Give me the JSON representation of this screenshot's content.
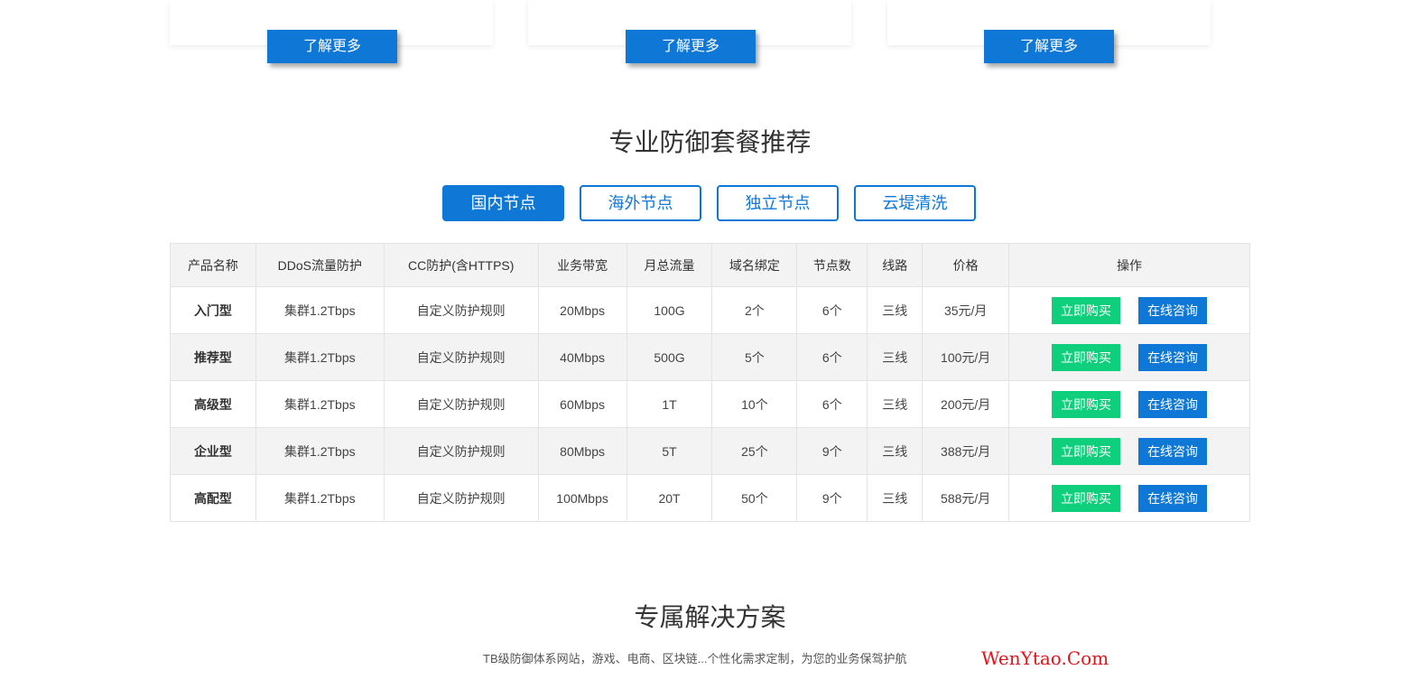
{
  "cards": [
    {
      "button_label": "了解更多"
    },
    {
      "button_label": "了解更多"
    },
    {
      "button_label": "了解更多"
    }
  ],
  "packages_section": {
    "title": "专业防御套餐推荐",
    "tabs": [
      {
        "label": "国内节点",
        "active": true
      },
      {
        "label": "海外节点",
        "active": false
      },
      {
        "label": "独立节点",
        "active": false
      },
      {
        "label": "云堤清洗",
        "active": false
      }
    ],
    "table": {
      "headers": [
        "产品名称",
        "DDoS流量防护",
        "CC防护(含HTTPS)",
        "业务带宽",
        "月总流量",
        "域名绑定",
        "节点数",
        "线路",
        "价格",
        "操作"
      ],
      "rows": [
        [
          "入门型",
          "集群1.2Tbps",
          "自定义防护规则",
          "20Mbps",
          "100G",
          "2个",
          "6个",
          "三线",
          "35元/月"
        ],
        [
          "推荐型",
          "集群1.2Tbps",
          "自定义防护规则",
          "40Mbps",
          "500G",
          "5个",
          "6个",
          "三线",
          "100元/月"
        ],
        [
          "高级型",
          "集群1.2Tbps",
          "自定义防护规则",
          "60Mbps",
          "1T",
          "10个",
          "6个",
          "三线",
          "200元/月"
        ],
        [
          "企业型",
          "集群1.2Tbps",
          "自定义防护规则",
          "80Mbps",
          "5T",
          "25个",
          "9个",
          "三线",
          "388元/月"
        ],
        [
          "高配型",
          "集群1.2Tbps",
          "自定义防护规则",
          "100Mbps",
          "20T",
          "50个",
          "9个",
          "三线",
          "588元/月"
        ]
      ],
      "buy_label": "立即购买",
      "consult_label": "在线咨询"
    }
  },
  "solutions_section": {
    "title": "专属解决方案",
    "subtitle": "TB级防御体系网站，游戏、电商、区块链...个性化需求定制，为您的业务保驾护航"
  },
  "watermark": "WenYtao.Com",
  "colors": {
    "primary_blue": "#0f77d6",
    "buy_green": "#10cf7c",
    "watermark_red": "#e0141c"
  }
}
